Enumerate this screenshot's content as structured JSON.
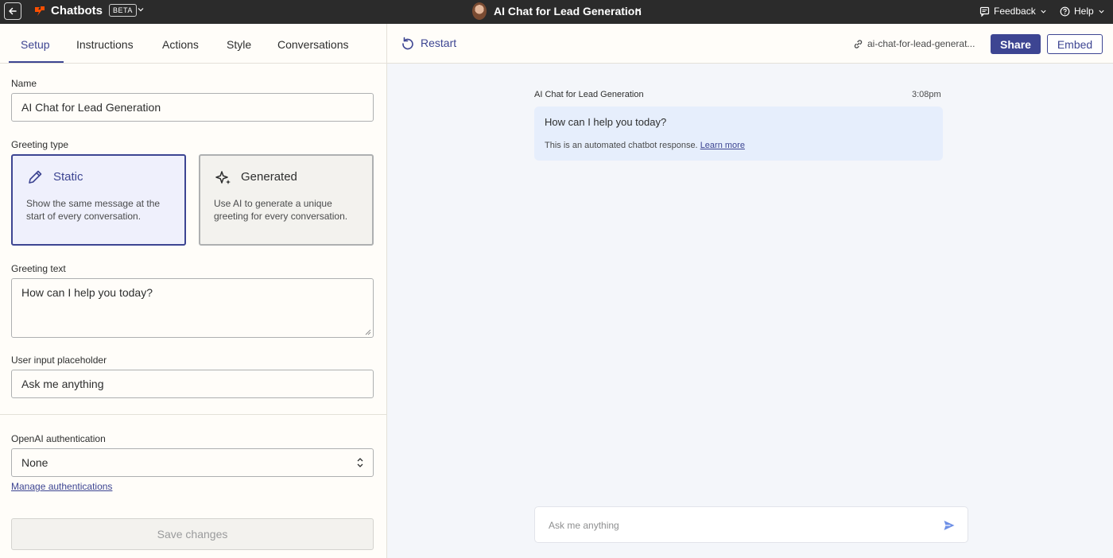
{
  "topbar": {
    "app_name": "Chatbots",
    "beta_badge": "BETA",
    "chatbot_title": "AI Chat for Lead Generation",
    "feedback_label": "Feedback",
    "help_label": "Help"
  },
  "tabs": [
    {
      "label": "Setup",
      "active": true
    },
    {
      "label": "Instructions",
      "active": false
    },
    {
      "label": "Actions",
      "active": false
    },
    {
      "label": "Style",
      "active": false
    },
    {
      "label": "Conversations",
      "active": false
    }
  ],
  "setup": {
    "name_label": "Name",
    "name_value": "AI Chat for Lead Generation",
    "greeting_type_label": "Greeting type",
    "greeting_types": [
      {
        "title": "Static",
        "description": "Show the same message at the start of every conversation.",
        "selected": true
      },
      {
        "title": "Generated",
        "description": "Use AI to generate a unique greeting for every conversation.",
        "selected": false
      }
    ],
    "greeting_text_label": "Greeting text",
    "greeting_text_value": "How can I help you today?",
    "placeholder_label": "User input placeholder",
    "placeholder_value": "Ask me anything",
    "openai_label": "OpenAI authentication",
    "openai_value": "None",
    "manage_link": "Manage authentications",
    "save_label": "Save changes"
  },
  "preview": {
    "restart_label": "Restart",
    "url_text": "ai-chat-for-lead-generat...",
    "share_label": "Share",
    "embed_label": "Embed",
    "bot_name": "AI Chat for Lead Generation",
    "timestamp": "3:08pm",
    "greeting": "How can I help you today?",
    "automated_note": "This is an automated chatbot response.",
    "learn_more": "Learn more",
    "input_placeholder": "Ask me anything"
  },
  "colors": {
    "accent": "#3d4592",
    "topbar_bg": "#2b2b2b",
    "brand_orange": "#ff4f00",
    "bubble_bg": "#e6eefc"
  }
}
